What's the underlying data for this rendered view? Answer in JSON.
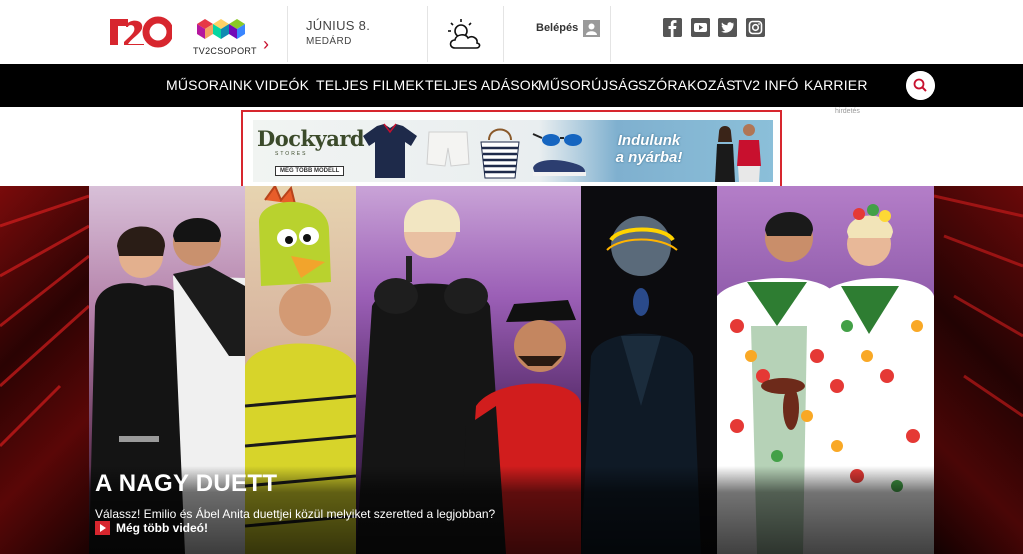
{
  "header": {
    "logo": "TV2",
    "group_logo_label": "TV2CSOPORT",
    "date": "JÚNIUS 8.",
    "nameday": "MEDÁRD",
    "weather_icon": "partly-cloudy-icon",
    "login_label": "Belépés",
    "social": [
      "facebook-icon",
      "youtube-icon",
      "twitter-icon",
      "instagram-icon"
    ]
  },
  "nav": {
    "items": [
      "MŰSORAINK",
      "VIDEÓK",
      "TELJES FILMEK",
      "TELJES ADÁSOK",
      "MŰSORÚJSÁG",
      "SZÓRAKOZÁS",
      "TV2 INFÓ",
      "KARRIER"
    ],
    "search_icon": "search-icon"
  },
  "ad": {
    "label": "hirdetés",
    "brand": "Dockyard",
    "brand_sub": "STORES",
    "more_label": "MÉG TÖBB MODELL",
    "headline_1": "Indulunk",
    "headline_2": "a nyárba!"
  },
  "hero": {
    "title": "A NAGY DUETT",
    "subtitle": "Válassz! Emilio és Ábel Anita duettjei közül melyiket szeretted a legjobban?",
    "more_label": "Még több videó!"
  },
  "colors": {
    "brand_red": "#d7262e",
    "nav_bg": "#000000"
  }
}
